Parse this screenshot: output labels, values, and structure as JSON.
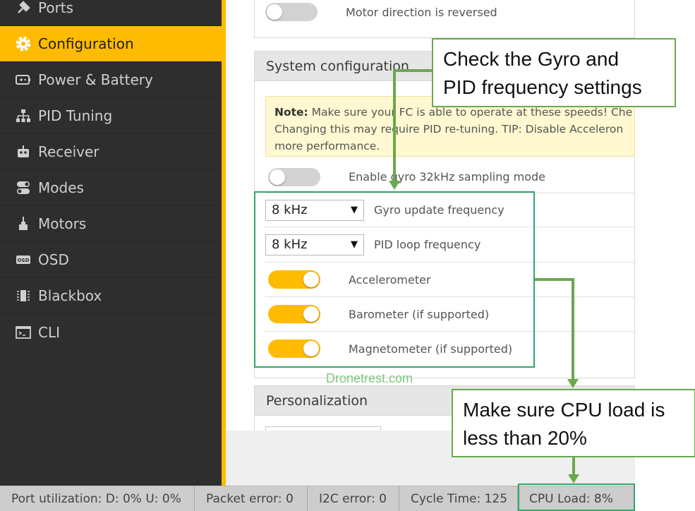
{
  "sidebar": {
    "items": [
      {
        "label": "Ports",
        "icon": "plug-icon"
      },
      {
        "label": "Configuration",
        "icon": "gear-icon",
        "active": true
      },
      {
        "label": "Power & Battery",
        "icon": "battery-icon"
      },
      {
        "label": "PID Tuning",
        "icon": "hierarchy-icon"
      },
      {
        "label": "Receiver",
        "icon": "robot-icon"
      },
      {
        "label": "Modes",
        "icon": "toggles-icon"
      },
      {
        "label": "Motors",
        "icon": "motor-icon"
      },
      {
        "label": "OSD",
        "icon": "osd-icon"
      },
      {
        "label": "Blackbox",
        "icon": "blackbox-icon"
      },
      {
        "label": "CLI",
        "icon": "terminal-icon"
      }
    ]
  },
  "motor_section": {
    "motor_reversed_label": "Motor direction is reversed",
    "motor_reversed_on": false
  },
  "system_config": {
    "title": "System configuration",
    "note_prefix": "Note:",
    "note_line1": "Make sure your FC is able to operate at these speeds! Che",
    "note_line2": "Changing this may require PID re-tuning. TIP: Disable Acceleron",
    "note_line3": "more performance.",
    "gyro32_label": "Enable gyro 32kHz sampling mode",
    "gyro32_on": false,
    "gyro_freq_value": "8 kHz",
    "gyro_freq_label": "Gyro update frequency",
    "pid_freq_value": "8 kHz",
    "pid_freq_label": "PID loop frequency",
    "accelerometer_label": "Accelerometer",
    "barometer_label": "Barometer (if supported)",
    "magnetometer_label": "Magnetometer (if supported)"
  },
  "personalization": {
    "title": "Personalization"
  },
  "statusbar": {
    "port_util": "Port utilization: D: 0% U: 0%",
    "packet_error": "Packet error: 0",
    "i2c_error": "I2C error: 0",
    "cycle_time": "Cycle Time: 125",
    "cpu_load": "CPU Load: 8%"
  },
  "annotations": {
    "callout_gyro_line1": "Check the Gyro and",
    "callout_gyro_line2": "PID frequency settings",
    "callout_cpu_line1": "Make sure CPU load is",
    "callout_cpu_line2": "less than 20%",
    "watermark": "Dronetrest.com"
  },
  "colors": {
    "accent": "#ffbb00",
    "sidebar_bg": "#2e2e2e",
    "annotation_green": "#6aa84f"
  }
}
